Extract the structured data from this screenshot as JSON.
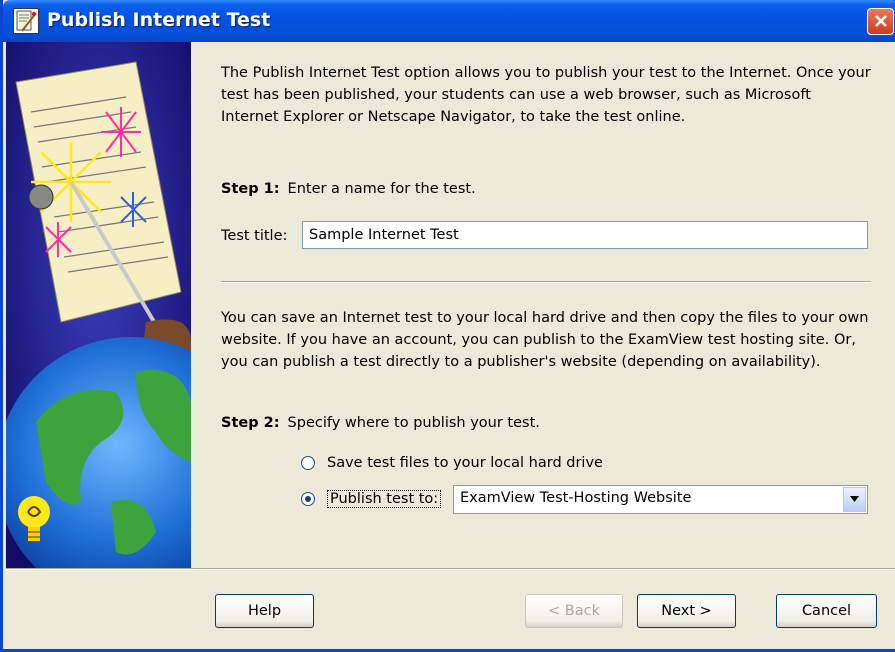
{
  "window": {
    "title": "Publish Internet Test",
    "title_icon": "exam-wizard-icon",
    "close_icon": "close-icon",
    "accent_color": "#0A5EEB",
    "close_color": "#CF3C1A"
  },
  "illustration": {
    "icon": "globe-test-paper-illustration",
    "tip_icon": "lightbulb-icon"
  },
  "intro_text": "The Publish Internet Test option allows you to publish your test to the Internet. Once your test has been published, your students can use a web browser, such as Microsoft Internet Explorer or Netscape Navigator, to take the test online.",
  "step1": {
    "label": "Step 1:",
    "text": "Enter a name for the test."
  },
  "test_title": {
    "label": "Test title:",
    "value": "Sample Internet Test"
  },
  "save_text": "You can save an Internet test to your local hard drive and then copy the files to your own website.  If you have an account, you can publish to the ExamView test hosting site.  Or, you can publish a test directly to a publisher's website (depending on availability).",
  "step2": {
    "label": "Step 2:",
    "text": "Specify where to publish your test."
  },
  "options": {
    "local": {
      "label": "Save test files to your local hard drive",
      "selected": false
    },
    "publish": {
      "label": "Publish test to:",
      "selected": true
    }
  },
  "destination": {
    "selected": "ExamView Test-Hosting Website"
  },
  "buttons": {
    "help": "Help",
    "back": "< Back",
    "next": "Next >",
    "cancel": "Cancel"
  }
}
